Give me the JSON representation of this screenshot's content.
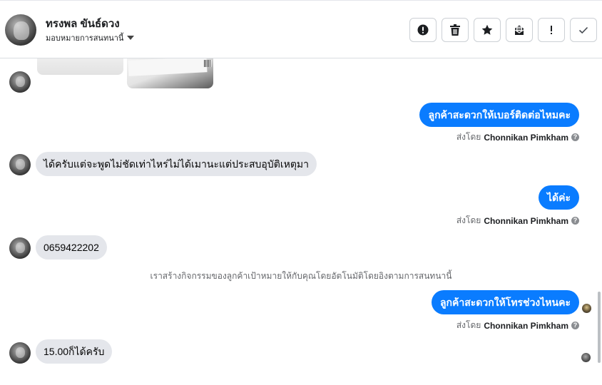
{
  "header": {
    "contact_name": "ทรงพล ขันธ์ดวง",
    "assign_label": "มอบหมายการสนทนานี้",
    "actions": [
      {
        "name": "mark-spam-button",
        "icon": "alert-circle-icon"
      },
      {
        "name": "delete-button",
        "icon": "trash-icon"
      },
      {
        "name": "star-button",
        "icon": "star-icon"
      },
      {
        "name": "mark-unread-button",
        "icon": "envelope-icon"
      },
      {
        "name": "follow-up-button",
        "icon": "exclamation-icon"
      },
      {
        "name": "mark-done-button",
        "icon": "check-icon"
      }
    ]
  },
  "messages": [
    {
      "direction": "out",
      "text": "ลูกค้าสะดวกให้เบอร์ติดต่อไหมคะ",
      "sent_by_prefix": "ส่งโดย",
      "sent_by_name": "Chonnikan Pimkham"
    },
    {
      "direction": "in",
      "text": "ได้ครับแต่จะพูดไม่ชัดเท่าไหร่ไม่ได้เมานะแต่ประสบอุบัติเหตุมา"
    },
    {
      "direction": "out",
      "text": "ได้ค่ะ",
      "sent_by_prefix": "ส่งโดย",
      "sent_by_name": "Chonnikan Pimkham"
    },
    {
      "direction": "in",
      "text": "0659422202"
    },
    {
      "direction": "system",
      "text": "เราสร้างกิจกรรมของลูกค้าเป้าหมายให้กับคุณโดยอัตโนมัติโดยอิงตามการสนทนานี้"
    },
    {
      "direction": "out",
      "text": "ลูกค้าสะดวกให้โทรช่วงไหนคะ",
      "sent_by_prefix": "ส่งโดย",
      "sent_by_name": "Chonnikan Pimkham"
    },
    {
      "direction": "in",
      "text": "15.00ก็ได้ครับ"
    }
  ],
  "colors": {
    "outgoing_bubble": "#0a7cff",
    "incoming_bubble": "#e4e6eb",
    "muted_text": "#65676b"
  }
}
